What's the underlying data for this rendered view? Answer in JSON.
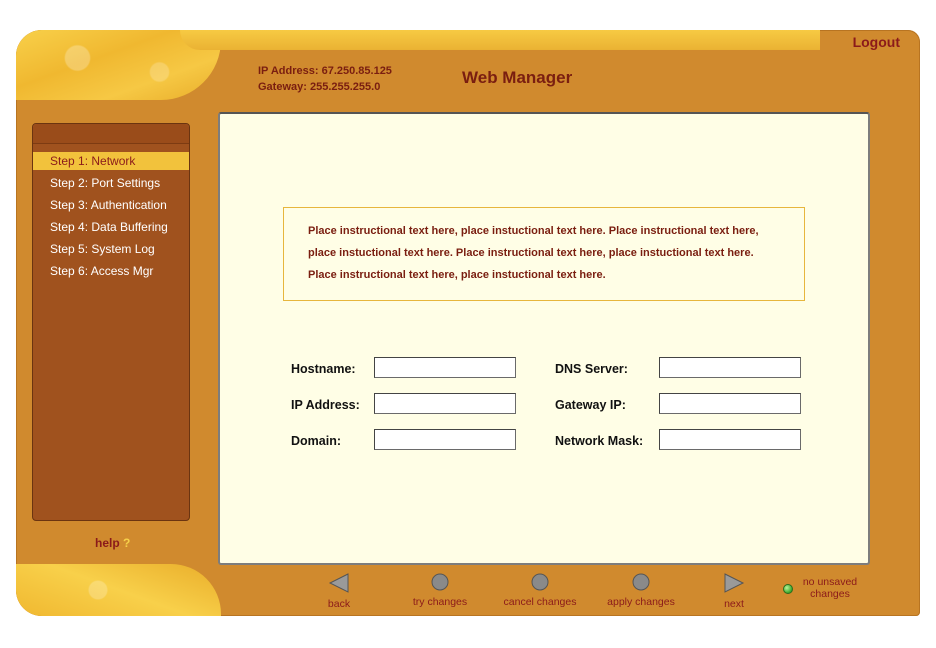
{
  "header": {
    "logout_label": "Logout",
    "ip_address_line": "IP Address:  67.250.85.125",
    "gateway_line": "Gateway:  255.255.255.0",
    "app_title": "Web Manager"
  },
  "sidebar": {
    "items": [
      {
        "label": "Step 1: Network",
        "active": true
      },
      {
        "label": "Step 2: Port Settings"
      },
      {
        "label": "Step 3: Authentication"
      },
      {
        "label": "Step 4: Data Buffering"
      },
      {
        "label": "Step 5: System Log"
      },
      {
        "label": "Step 6: Access Mgr"
      }
    ],
    "help_label": "help",
    "help_mark": "?"
  },
  "instructions": {
    "line1": "Place instructional text here, place instuctional text here.  Place instructional text here,",
    "line2": "place instuctional text here.  Place instructional text here, place instuctional text here.",
    "line3": "Place instructional text here, place instuctional text here."
  },
  "form": {
    "hostname_label": "Hostname:",
    "hostname_value": "",
    "ip_address_label": "IP Address:",
    "ip_address_value": "",
    "domain_label": "Domain:",
    "domain_value": "",
    "dns_server_label": "DNS Server:",
    "dns_server_value": "",
    "gateway_ip_label": "Gateway IP:",
    "gateway_ip_value": "",
    "network_mask_label": "Network Mask:",
    "network_mask_value": ""
  },
  "toolbar": {
    "back_label": "back",
    "try_label": "try changes",
    "cancel_label": "cancel changes",
    "apply_label": "apply changes",
    "next_label": "next",
    "status_label": "no unsaved changes"
  },
  "colors": {
    "frame": "#D08A2E",
    "sidebar": "#A0521E",
    "content_bg": "#FFFEE6",
    "accent_text": "#8B1A1A",
    "active_item": "#F2C23C"
  }
}
